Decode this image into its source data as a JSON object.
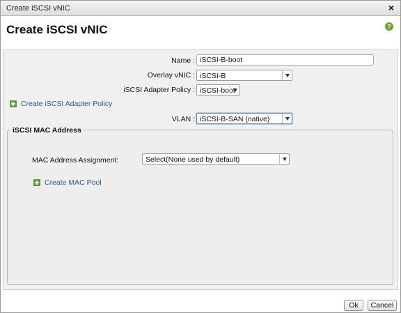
{
  "window": {
    "title": "Create iSCSI vNIC",
    "close_glyph": "×"
  },
  "header": {
    "title": "Create iSCSI vNIC",
    "help_glyph": "?"
  },
  "form": {
    "name": {
      "label": "Name :",
      "value": "iSCSI-B-boot"
    },
    "overlay_vnic": {
      "label": "Overlay vNIC :",
      "value": "iSCSI-B"
    },
    "adapter_policy": {
      "label": "iSCSI Adapter Policy :",
      "value": "iSCSI-boot"
    },
    "create_adapter_policy_link": "Create iSCSI Adapter Policy",
    "vlan": {
      "label": "VLAN :",
      "value": "iSCSI-B-SAN (native)"
    }
  },
  "mac_section": {
    "legend": "iSCSI MAC Address",
    "assignment": {
      "label": "MAC Address Assignment:",
      "value": "Select(None used by default)"
    },
    "create_mac_pool_link": "Create MAC Pool"
  },
  "footer": {
    "ok_label": "Ok",
    "cancel_label": "Cancel"
  },
  "icons": {
    "help": "help-icon",
    "add": "plus-icon",
    "close": "close-icon",
    "dropdown": "chevron-down-icon"
  },
  "colors": {
    "link": "#1e5a94",
    "add_icon": "#5aa02c",
    "help_icon": "#6aa52a"
  }
}
